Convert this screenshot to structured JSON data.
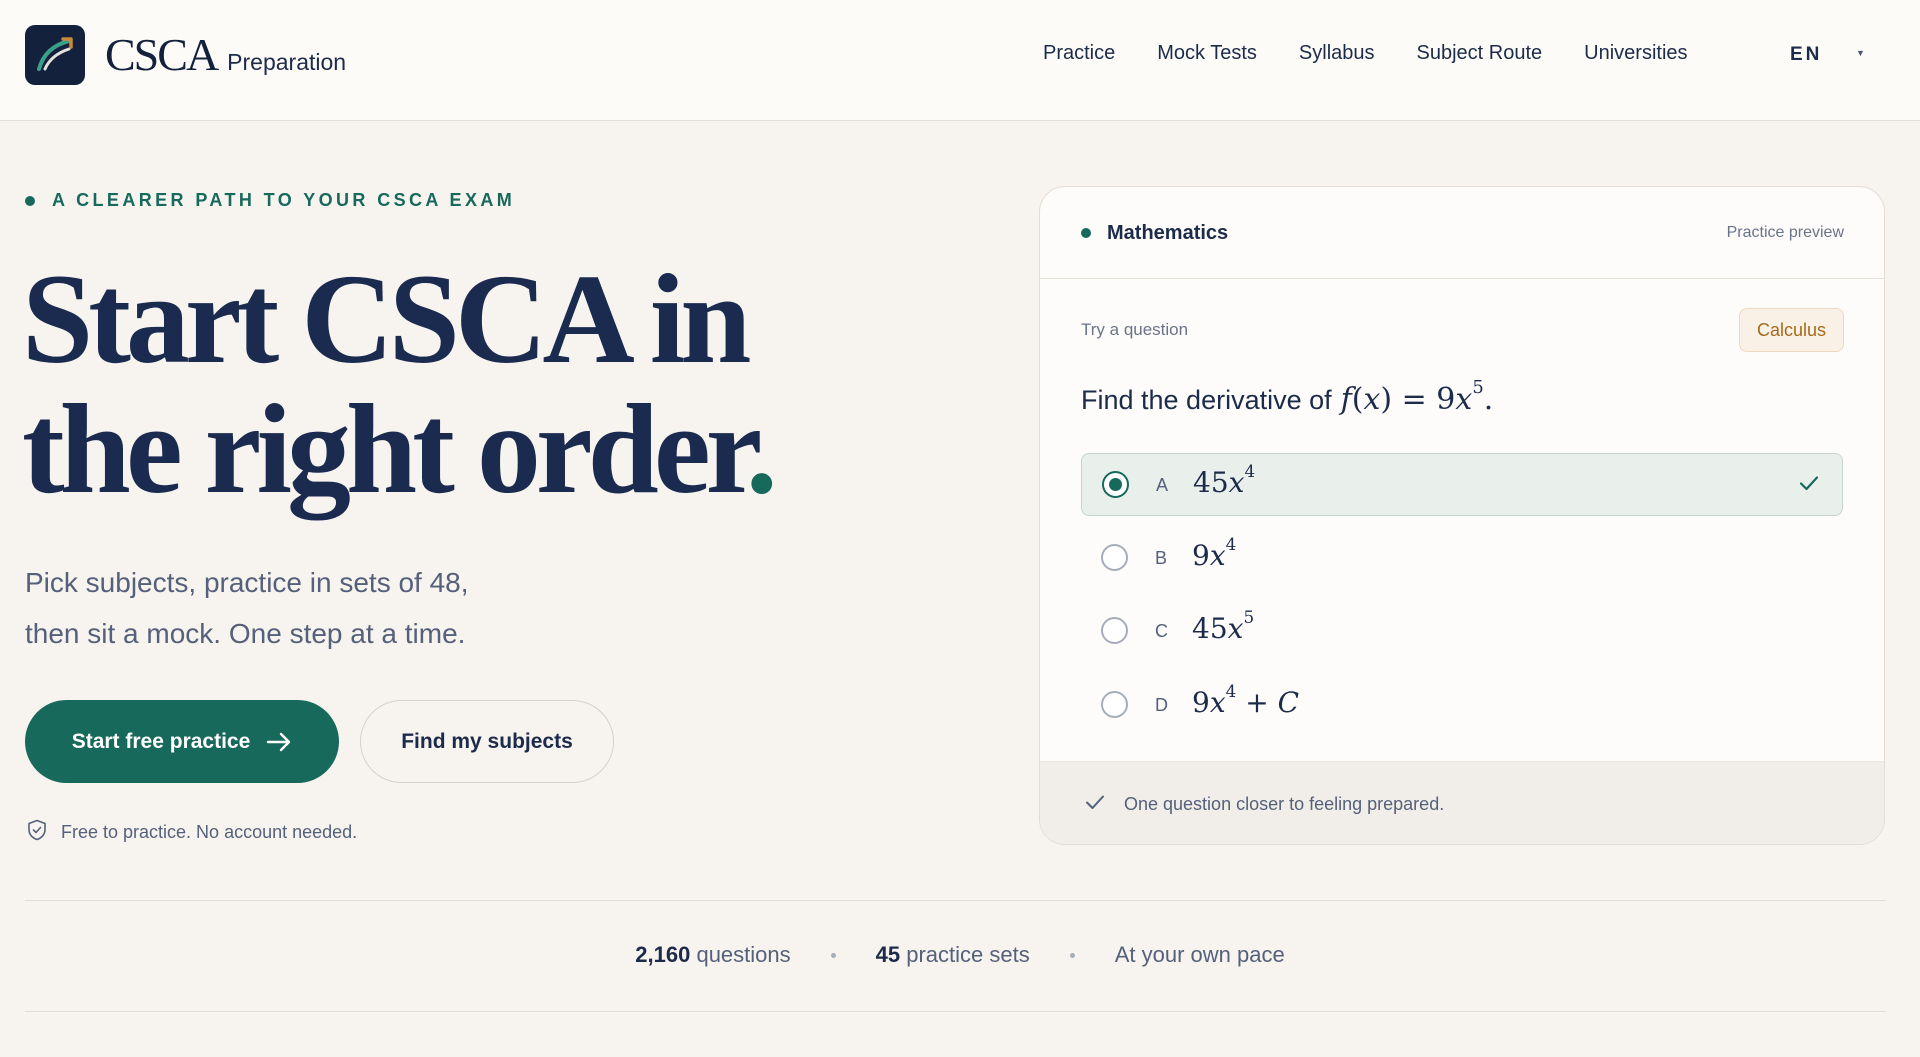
{
  "header": {
    "brand_main": "CSCA",
    "brand_sub": "Preparation",
    "nav": [
      "Practice",
      "Mock Tests",
      "Syllabus",
      "Subject Route",
      "Universities"
    ],
    "language": "EN"
  },
  "hero": {
    "eyebrow": "A CLEARER PATH TO YOUR CSCA EXAM",
    "headline_line1": "Start CSCA in",
    "headline_line2": "the right order",
    "headline_dot": ".",
    "subtitle_line1": "Pick subjects, practice in sets of 48,",
    "subtitle_line2": "then sit a mock. One step at a time.",
    "primary_cta": "Start free practice",
    "secondary_cta": "Find my subjects",
    "free_note": "Free to practice. No account needed."
  },
  "card": {
    "subject": "Mathematics",
    "preview_label": "Practice preview",
    "try_label": "Try a question",
    "topic": "Calculus",
    "question_text": "Find the derivative of",
    "selected_option": "A",
    "options": [
      {
        "letter": "A"
      },
      {
        "letter": "B"
      },
      {
        "letter": "C"
      },
      {
        "letter": "D"
      }
    ],
    "footer_text": "One question closer to feeling prepared."
  },
  "stats": [
    {
      "value": "2,160",
      "label": "questions"
    },
    {
      "value": "45",
      "label": "practice sets"
    },
    {
      "value": "",
      "label": "At your own pace"
    }
  ],
  "colors": {
    "accent": "#17695b",
    "navy": "#1a2b4f",
    "background": "#f7f4f0",
    "badge_text": "#a56a1c"
  }
}
